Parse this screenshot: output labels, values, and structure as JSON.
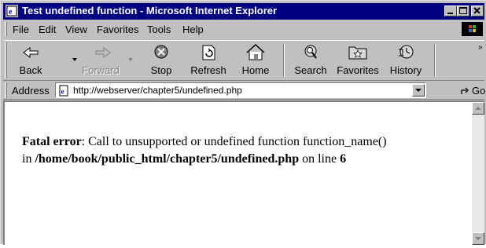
{
  "window": {
    "title": "Test undefined function - Microsoft Internet Explorer",
    "controls": [
      "minimize-icon",
      "maximize-icon",
      "close-icon"
    ]
  },
  "menu": {
    "file": "File",
    "edit": "Edit",
    "view": "View",
    "favorites": "Favorites",
    "tools": "Tools",
    "help": "Help"
  },
  "toolbar": {
    "back": "Back",
    "forward": "Forward",
    "stop": "Stop",
    "refresh": "Refresh",
    "home": "Home",
    "search": "Search",
    "favorites": "Favorites",
    "history": "History",
    "forward_disabled": true
  },
  "address": {
    "label": "Address",
    "url": "http://webserver/chapter5/undefined.php",
    "go": "Go"
  },
  "document": {
    "error_label": "Fatal error",
    "message": ": Call to unsupported or undefined function function_name()",
    "in_text": "in",
    "path": "/home/book/public_html/chapter5/undefined.php",
    "on_line_text": "on line",
    "line": "6"
  },
  "colors": {
    "titlebar": "#000080",
    "chrome": "#c0c0c0",
    "content_bg": "#ffffff"
  }
}
